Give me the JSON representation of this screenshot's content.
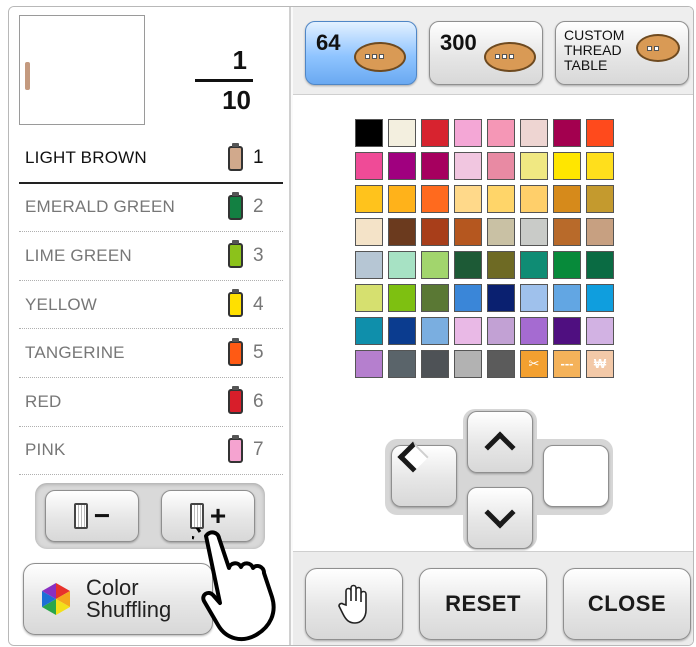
{
  "preview": {
    "swatch_color": "#c49a7f"
  },
  "counter": {
    "current": "1",
    "total": "10"
  },
  "threads": [
    {
      "name": "LIGHT BROWN",
      "index": "1",
      "color": "#d1a98c",
      "selected": true
    },
    {
      "name": "EMERALD GREEN",
      "index": "2",
      "color": "#138042",
      "selected": false
    },
    {
      "name": "LIME GREEN",
      "index": "3",
      "color": "#8cc21b",
      "selected": false
    },
    {
      "name": "YELLOW",
      "index": "4",
      "color": "#ffe000",
      "selected": false
    },
    {
      "name": "TANGERINE",
      "index": "5",
      "color": "#ff5a14",
      "selected": false
    },
    {
      "name": "RED",
      "index": "6",
      "color": "#d81e2a",
      "selected": false
    },
    {
      "name": "PINK",
      "index": "7",
      "color": "#f5a3d0",
      "selected": false
    }
  ],
  "buttons": {
    "remove_thread_icon": "spool-minus-icon",
    "add_thread_icon": "spool-plus-icon",
    "shuffle_line1": "Color",
    "shuffle_line2": "Shuffling",
    "reset": "RESET",
    "close": "CLOSE",
    "hand_icon": "hand-icon"
  },
  "tabs": {
    "t64": "64",
    "t300": "300",
    "custom_line1": "CUSTOM",
    "custom_line2": "THREAD",
    "custom_line3": "TABLE"
  },
  "palette": [
    "#000000",
    "#f3efdf",
    "#d7232f",
    "#f4a7d6",
    "#f597b6",
    "#eed5d2",
    "#a3004f",
    "#ff4a1c",
    "#ef4b97",
    "#a0007f",
    "#a6005f",
    "#f1c6e0",
    "#e88aa3",
    "#f0e882",
    "#ffe600",
    "#ffdf1c",
    "#ffc31c",
    "#ffb21a",
    "#ff6a1e",
    "#ffd98a",
    "#ffd569",
    "#ffcf6a",
    "#d68a1b",
    "#c49a2e",
    "#f4e3c8",
    "#6b3a1e",
    "#a83e1a",
    "#b5571f",
    "#c9c1a4",
    "#c9cbc8",
    "#b86a2a",
    "#c7a081",
    "#b6c6d4",
    "#a7e2c4",
    "#a2d56d",
    "#1d5a36",
    "#6e6a24",
    "#0f8c74",
    "#078a3a",
    "#0a6b43",
    "#d6e06f",
    "#7ec011",
    "#5a7834",
    "#3a86d8",
    "#0a2070",
    "#9fc1ec",
    "#62a6e3",
    "#0f9ede",
    "#0f8fab",
    "#0b3c8f",
    "#7aaee0",
    "#e9b9e6",
    "#c2a1d4",
    "#a56bd1",
    "#4f0f80",
    "#d2b2e3",
    "#b57fce",
    "#5a646a",
    "#4e5256",
    "#b2b2b2",
    "#5b5b5b",
    "#f3a030",
    "#f4b25a",
    "#f3c9a8"
  ],
  "palette_special": {
    "61": "✂",
    "62": "---",
    "63": "₩"
  }
}
